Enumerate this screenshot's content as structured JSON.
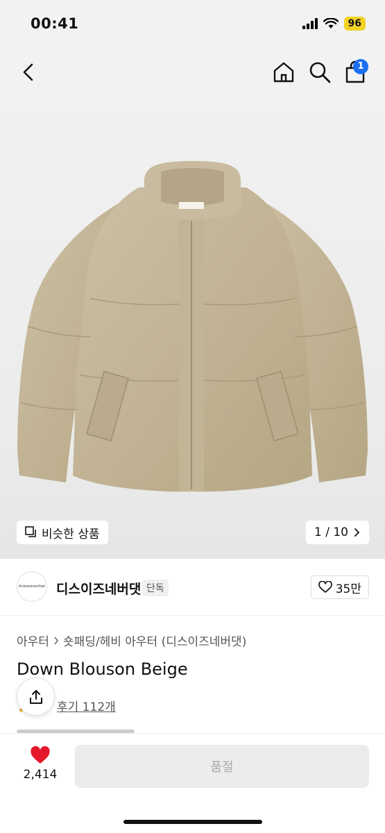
{
  "status": {
    "time": "00:41",
    "battery": "96"
  },
  "nav": {
    "cart_count": "1"
  },
  "gallery": {
    "similar_label": "비슷한 상품",
    "page_indicator": "1 / 10"
  },
  "brand": {
    "logo_text": "thisisneverthat",
    "name": "디스이즈네버댓",
    "tag": "단독",
    "likes": "35만"
  },
  "product": {
    "breadcrumb": [
      "아우터",
      "숏패딩/헤비 아우터 (디스이즈네버댓)"
    ],
    "title": "Down Blouson Beige",
    "reviews": "후기 112개"
  },
  "bottom": {
    "wish_count": "2,414",
    "buy_label": "품절"
  },
  "colors": {
    "heart": "#e6172b",
    "badge": "#1c6ef0",
    "battery": "#f2d224",
    "jacket": "#c4b69a"
  },
  "icons": [
    "back-icon",
    "home-icon",
    "search-icon",
    "cart-icon",
    "similar-icon",
    "chevron-right-icon",
    "heart-outline-icon",
    "share-icon",
    "heart-filled-icon"
  ]
}
